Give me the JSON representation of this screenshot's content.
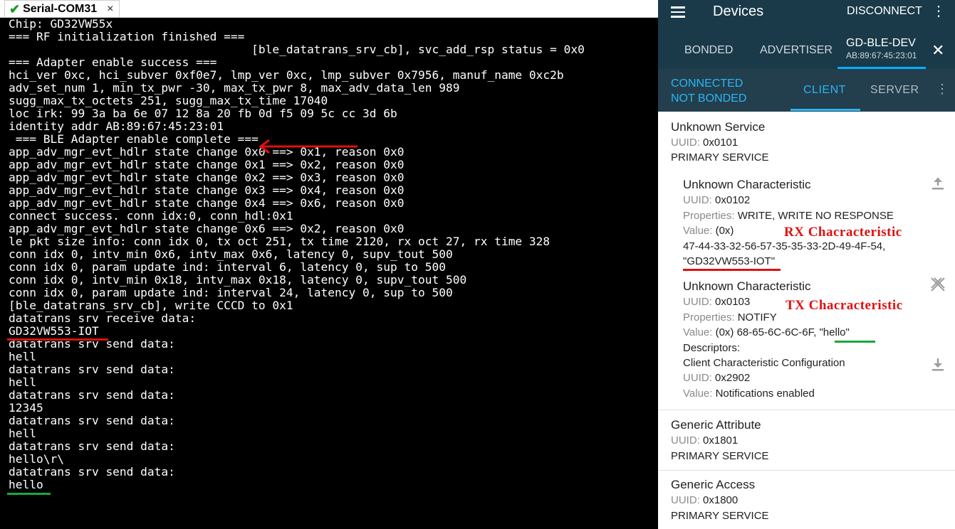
{
  "terminal": {
    "tab_title": "Serial-COM31",
    "tab_close": "×",
    "check_glyph": "✔",
    "lines": [
      "Chip: GD32VW55x",
      "=== RF initialization finished ===",
      "                                   [ble_datatrans_srv_cb], svc_add_rsp status = 0x0",
      "=== Adapter enable success ===",
      "hci_ver 0xc, hci_subver 0xf0e7, lmp_ver 0xc, lmp_subver 0x7956, manuf_name 0xc2b",
      "adv_set_num 1, min_tx_pwr -30, max_tx_pwr 8, max_adv_data_len 989",
      "sugg_max_tx_octets 251, sugg_max_tx_time 17040",
      "loc irk: 99 3a ba 6e 07 12 8a 20 fb 0d f5 09 5c cc 3d 6b",
      "identity addr AB:89:67:45:23:01",
      " === BLE Adapter enable complete ===",
      "app_adv_mgr_evt_hdlr state change 0x0 ==> 0x1, reason 0x0",
      "app_adv_mgr_evt_hdlr state change 0x1 ==> 0x2, reason 0x0",
      "app_adv_mgr_evt_hdlr state change 0x2 ==> 0x3, reason 0x0",
      "app_adv_mgr_evt_hdlr state change 0x3 ==> 0x4, reason 0x0",
      "app_adv_mgr_evt_hdlr state change 0x4 ==> 0x6, reason 0x0",
      "connect success. conn idx:0, conn_hdl:0x1",
      "app_adv_mgr_evt_hdlr state change 0x6 ==> 0x2, reason 0x0",
      "le pkt size info: conn idx 0, tx oct 251, tx time 2120, rx oct 27, rx time 328",
      "conn idx 0, intv_min 0x6, intv_max 0x6, latency 0, supv_tout 500",
      "conn idx 0, param update ind: interval 6, latency 0, sup to 500",
      "conn idx 0, intv_min 0x18, intv_max 0x18, latency 0, supv_tout 500",
      "conn idx 0, param update ind: interval 24, latency 0, sup to 500",
      "[ble_datatrans_srv_cb], write CCCD to 0x1",
      "datatrans srv receive data:",
      "GD32VW553-IOT",
      "datatrans srv send data:",
      "hell",
      "datatrans srv send data:",
      "hell",
      "datatrans srv send data:",
      "12345",
      "datatrans srv send data:",
      "hell",
      "datatrans srv send data:",
      "hello\\r\\",
      "datatrans srv send data:",
      "hello"
    ]
  },
  "colors": {
    "appbar": "#1a3a4a",
    "accent": "#29b6f6",
    "annotation_red": "#e01010",
    "annotation_green": "#1aa83a",
    "ok_green": "#1a9a2a"
  },
  "app": {
    "title": "Devices",
    "disconnect_label": "DISCONNECT",
    "overflow_glyph": "⋮",
    "tabs": {
      "bonded": "BONDED",
      "advertiser": "ADVERTISER"
    },
    "device": {
      "name": "GD-BLE-DEV",
      "address": "AB:89:67:45:23:01"
    },
    "close_glyph": "✕",
    "status_line1": "CONNECTED",
    "status_line2": "NOT BONDED",
    "subtabs": {
      "client": "CLIENT",
      "server": "SERVER"
    },
    "services": [
      {
        "name": "Unknown Service",
        "uuid_label": "UUID:",
        "uuid": "0x0101",
        "type": "PRIMARY SERVICE",
        "characteristics": [
          {
            "name": "Unknown Characteristic",
            "uuid_label": "UUID:",
            "uuid": "0x0102",
            "properties_label": "Properties:",
            "properties": "WRITE, WRITE NO RESPONSE",
            "value_label": "Value:",
            "value_prefix": "(0x)",
            "value_hex": "47-44-33-32-56-57-35-35-33-2D-49-4F-54,",
            "value_text": "\"GD32VW553-IOT\"",
            "icon": "upload-icon"
          },
          {
            "name": "Unknown Characteristic",
            "uuid_label": "UUID:",
            "uuid": "0x0103",
            "properties_label": "Properties:",
            "properties": "NOTIFY",
            "value_label": "Value:",
            "value_prefix": "(0x) 68-65-6C-6C-6F,",
            "value_text": "\"hello\"",
            "descriptors_label": "Descriptors:",
            "descriptor_name": "Client Characteristic Configuration",
            "descriptor_uuid_label": "UUID:",
            "descriptor_uuid": "0x2902",
            "descriptor_value_label": "Value:",
            "descriptor_value": "Notifications enabled",
            "icon": "notifications-disabled-icon"
          }
        ]
      },
      {
        "name": "Generic Attribute",
        "uuid_label": "UUID:",
        "uuid": "0x1801",
        "type": "PRIMARY SERVICE"
      },
      {
        "name": "Generic Access",
        "uuid_label": "UUID:",
        "uuid": "0x1800",
        "type": "PRIMARY SERVICE"
      }
    ]
  },
  "annotations": {
    "rx_label": "RX Chacracteristic",
    "tx_label": "TX Chacracteristic"
  }
}
